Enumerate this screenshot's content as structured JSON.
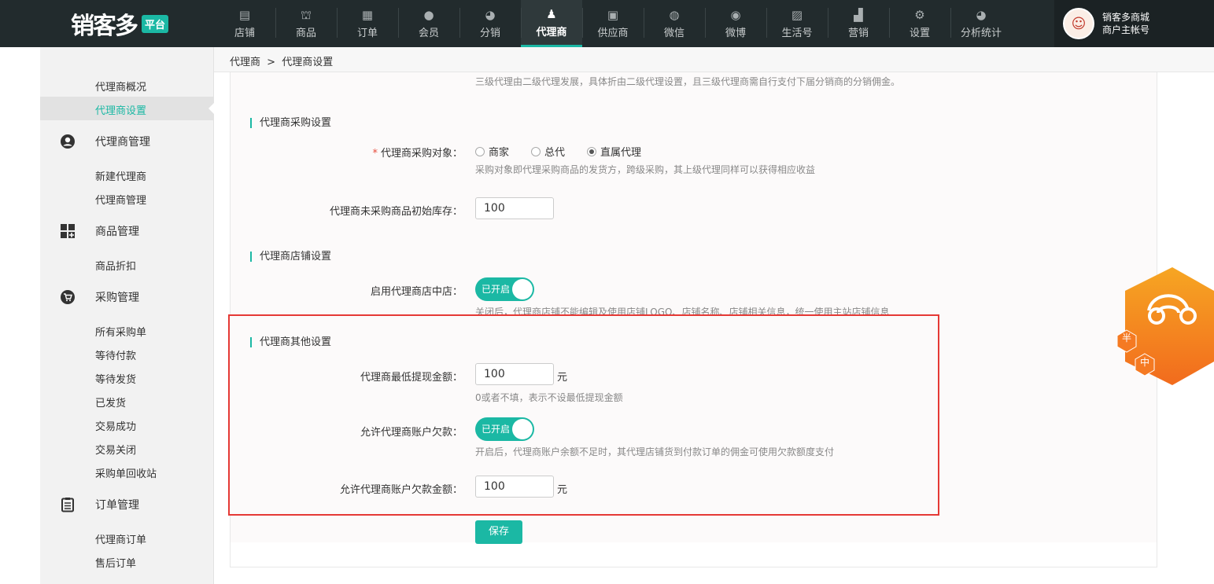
{
  "header": {
    "logo_text": "销客多",
    "logo_badge": "平台",
    "nav": [
      {
        "label": "店铺",
        "icon": "store-icon"
      },
      {
        "label": "商品",
        "icon": "basket-icon"
      },
      {
        "label": "订单",
        "icon": "clipboard-icon"
      },
      {
        "label": "会员",
        "icon": "user-icon"
      },
      {
        "label": "分销",
        "icon": "pie-icon"
      },
      {
        "label": "代理商",
        "icon": "agent-icon",
        "active": true
      },
      {
        "label": "供应商",
        "icon": "supplier-icon"
      },
      {
        "label": "微信",
        "icon": "wechat-icon"
      },
      {
        "label": "微博",
        "icon": "weibo-icon"
      },
      {
        "label": "生活号",
        "icon": "alipay-icon"
      },
      {
        "label": "营销",
        "icon": "chart-icon"
      },
      {
        "label": "设置",
        "icon": "gear-icon"
      },
      {
        "label": "分析统计",
        "icon": "pie-icon"
      }
    ],
    "account": {
      "name": "销客多商城",
      "role": "商户主帐号"
    }
  },
  "breadcrumb": {
    "root": "代理商",
    "sep": ">",
    "current": "代理商设置"
  },
  "sidebar": {
    "top_items": [
      "代理商概况",
      "代理商设置"
    ],
    "groups": [
      {
        "title": "代理商管理",
        "items": [
          "新建代理商",
          "代理商管理"
        ]
      },
      {
        "title": "商品管理",
        "items": [
          "商品折扣"
        ]
      },
      {
        "title": "采购管理",
        "items": [
          "所有采购单",
          "等待付款",
          "等待发货",
          "已发货",
          "交易成功",
          "交易关闭",
          "采购单回收站"
        ]
      },
      {
        "title": "订单管理",
        "items": [
          "代理商订单",
          "售后订单"
        ]
      }
    ]
  },
  "form": {
    "top_hint": "三级代理由二级代理发展，具体折由二级代理设置，且三级代理商需自行支付下届分销商的分销佣金。",
    "purchase": {
      "title": "代理商采购设置",
      "target_label": "代理商采购对象：",
      "required_mark": "*",
      "options": [
        "商家",
        "总代",
        "直属代理"
      ],
      "selected": "直属代理",
      "target_hint": "采购对象即代理采购商品的发货方，跨级采购，其上级代理同样可以获得相应收益",
      "stock_label": "代理商未采购商品初始库存：",
      "stock_value": "100"
    },
    "shop": {
      "title": "代理商店铺设置",
      "enable_label": "启用代理商店中店：",
      "enable_state": "已开启",
      "enable_hint": "关闭后，代理商店铺不能编辑及使用店铺LOGO、店铺名称、店铺相关信息，统一使用主站店铺信息"
    },
    "other": {
      "title": "代理商其他设置",
      "min_withdraw_label": "代理商最低提现金额：",
      "min_withdraw_value": "100",
      "min_withdraw_unit": "元",
      "min_withdraw_hint": "0或者不填，表示不设最低提现金额",
      "allow_debt_label": "允许代理商账户欠款：",
      "allow_debt_state": "已开启",
      "allow_debt_hint": "开启后，代理商账户余额不足时，其代理店铺货到付款订单的佣金可使用欠款额度支付",
      "debt_amount_label": "允许代理商账户欠款金额：",
      "debt_amount_value": "100",
      "debt_amount_unit": "元"
    },
    "save_label": "保存"
  },
  "widget": {
    "chars": [
      "半",
      "中"
    ]
  },
  "colors": {
    "accent": "#1bb8a4",
    "topbar": "#222b2d",
    "highlight": "#e53935"
  }
}
